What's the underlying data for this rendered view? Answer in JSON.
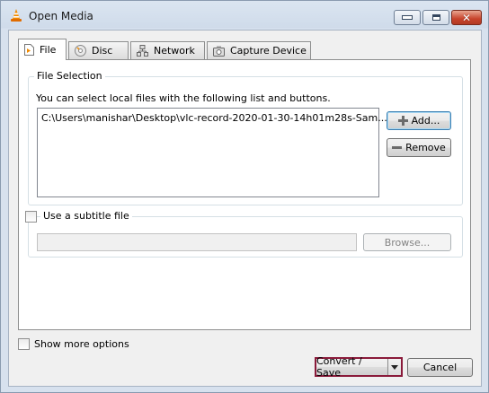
{
  "window": {
    "title": "Open Media"
  },
  "tabs": [
    {
      "label": "File"
    },
    {
      "label": "Disc"
    },
    {
      "label": "Network"
    },
    {
      "label": "Capture Device"
    }
  ],
  "file_selection": {
    "title": "File Selection",
    "description": "You can select local files with the following list and buttons.",
    "files": [
      "C:\\Users\\manishar\\Desktop\\vlc-record-2020-01-30-14h01m28s-Sam..."
    ],
    "add_label": "Add...",
    "remove_label": "Remove"
  },
  "subtitle": {
    "checkbox_label": "Use a subtitle file",
    "path_value": "",
    "browse_label": "Browse..."
  },
  "footer": {
    "show_more_label": "Show more options",
    "convert_label": "Convert / Save",
    "cancel_label": "Cancel"
  }
}
